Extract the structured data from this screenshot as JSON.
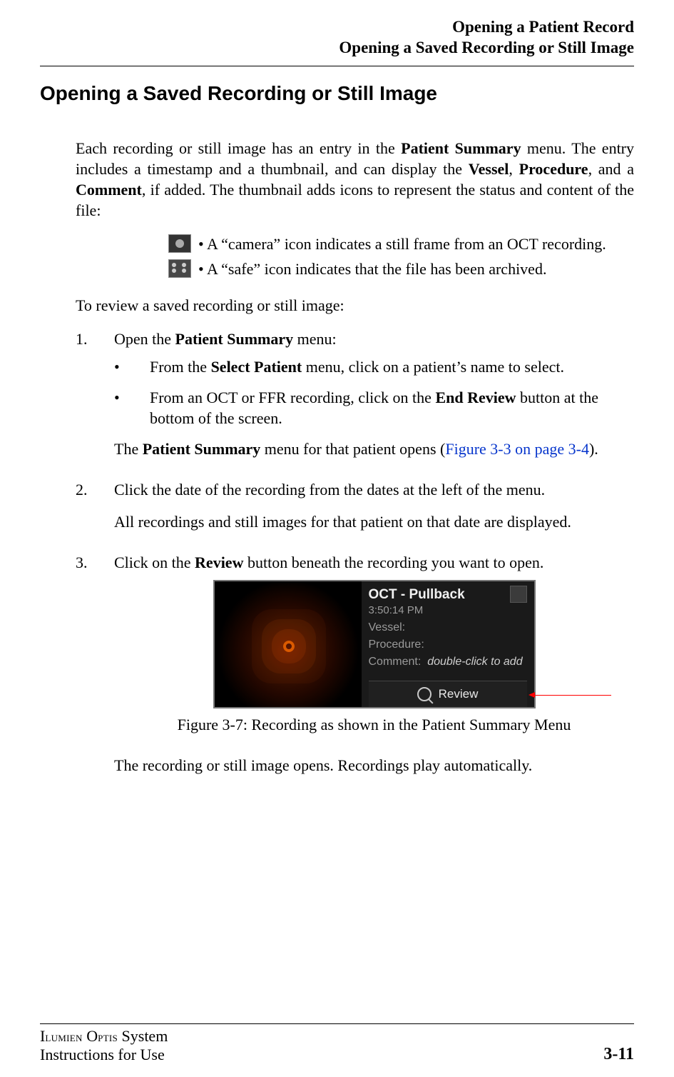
{
  "header": {
    "line1": "Opening a Patient Record",
    "line2": "Opening a Saved Recording or Still Image"
  },
  "section_title": "Opening a Saved Recording or Still Image",
  "intro": {
    "pre1": "Each recording or still image has an entry in the ",
    "b1": "Patient Summary",
    "mid1": " menu. The entry includes a timestamp and a thumbnail, and can display the ",
    "b2": "Vessel",
    "sep1": ", ",
    "b3": "Procedure",
    "sep2": ", and a ",
    "b4": "Comment",
    "post": ", if added.  The thumbnail adds icons to represent the status and content of the file:"
  },
  "icon_items": {
    "camera": "• A “camera” icon indicates a still frame from an OCT recording.",
    "safe": "• A “safe” icon indicates that the file has been archived."
  },
  "to_review": "To review a saved recording or still image:",
  "steps": {
    "s1": {
      "num": "1.",
      "pre": "Open the ",
      "b": "Patient Summary",
      "post": " menu:",
      "sub1_pre": "From the ",
      "sub1_b": "Select Patient",
      "sub1_post": " menu, click on a patient’s name to select.",
      "sub2_pre": "From an OCT or FFR recording, click on the ",
      "sub2_b": "End Review",
      "sub2_post": " button at the bottom of the screen.",
      "after_pre": "The ",
      "after_b": "Patient Summary",
      "after_mid": " menu for that patient opens (",
      "after_link": "Figure 3-3 on page 3-4",
      "after_post": ")."
    },
    "s2": {
      "num": "2.",
      "text": "Click the date of the recording from the dates at the left of the menu.",
      "after": "All recordings and still images for that patient on that date are displayed."
    },
    "s3": {
      "num": "3.",
      "pre": "Click on the ",
      "b": "Review",
      "post": " button beneath the recording you want to open."
    }
  },
  "figure": {
    "title": "OCT - Pullback",
    "time": "3:50:14 PM",
    "vessel_label": "Vessel:",
    "procedure_label": "Procedure:",
    "comment_label": "Comment:",
    "comment_hint": "double-click to add",
    "review_label": "Review",
    "caption": "Figure 3-7:  Recording as shown in the Patient Summary Menu"
  },
  "after_figure": "The recording or still image opens. Recordings play automatically.",
  "footer": {
    "system_pre": "I",
    "system_sc1": "lumien",
    "system_mid": " O",
    "system_sc2": "ptis",
    "system_post": " System",
    "ifu": "Instructions for Use",
    "page": "3-11"
  }
}
